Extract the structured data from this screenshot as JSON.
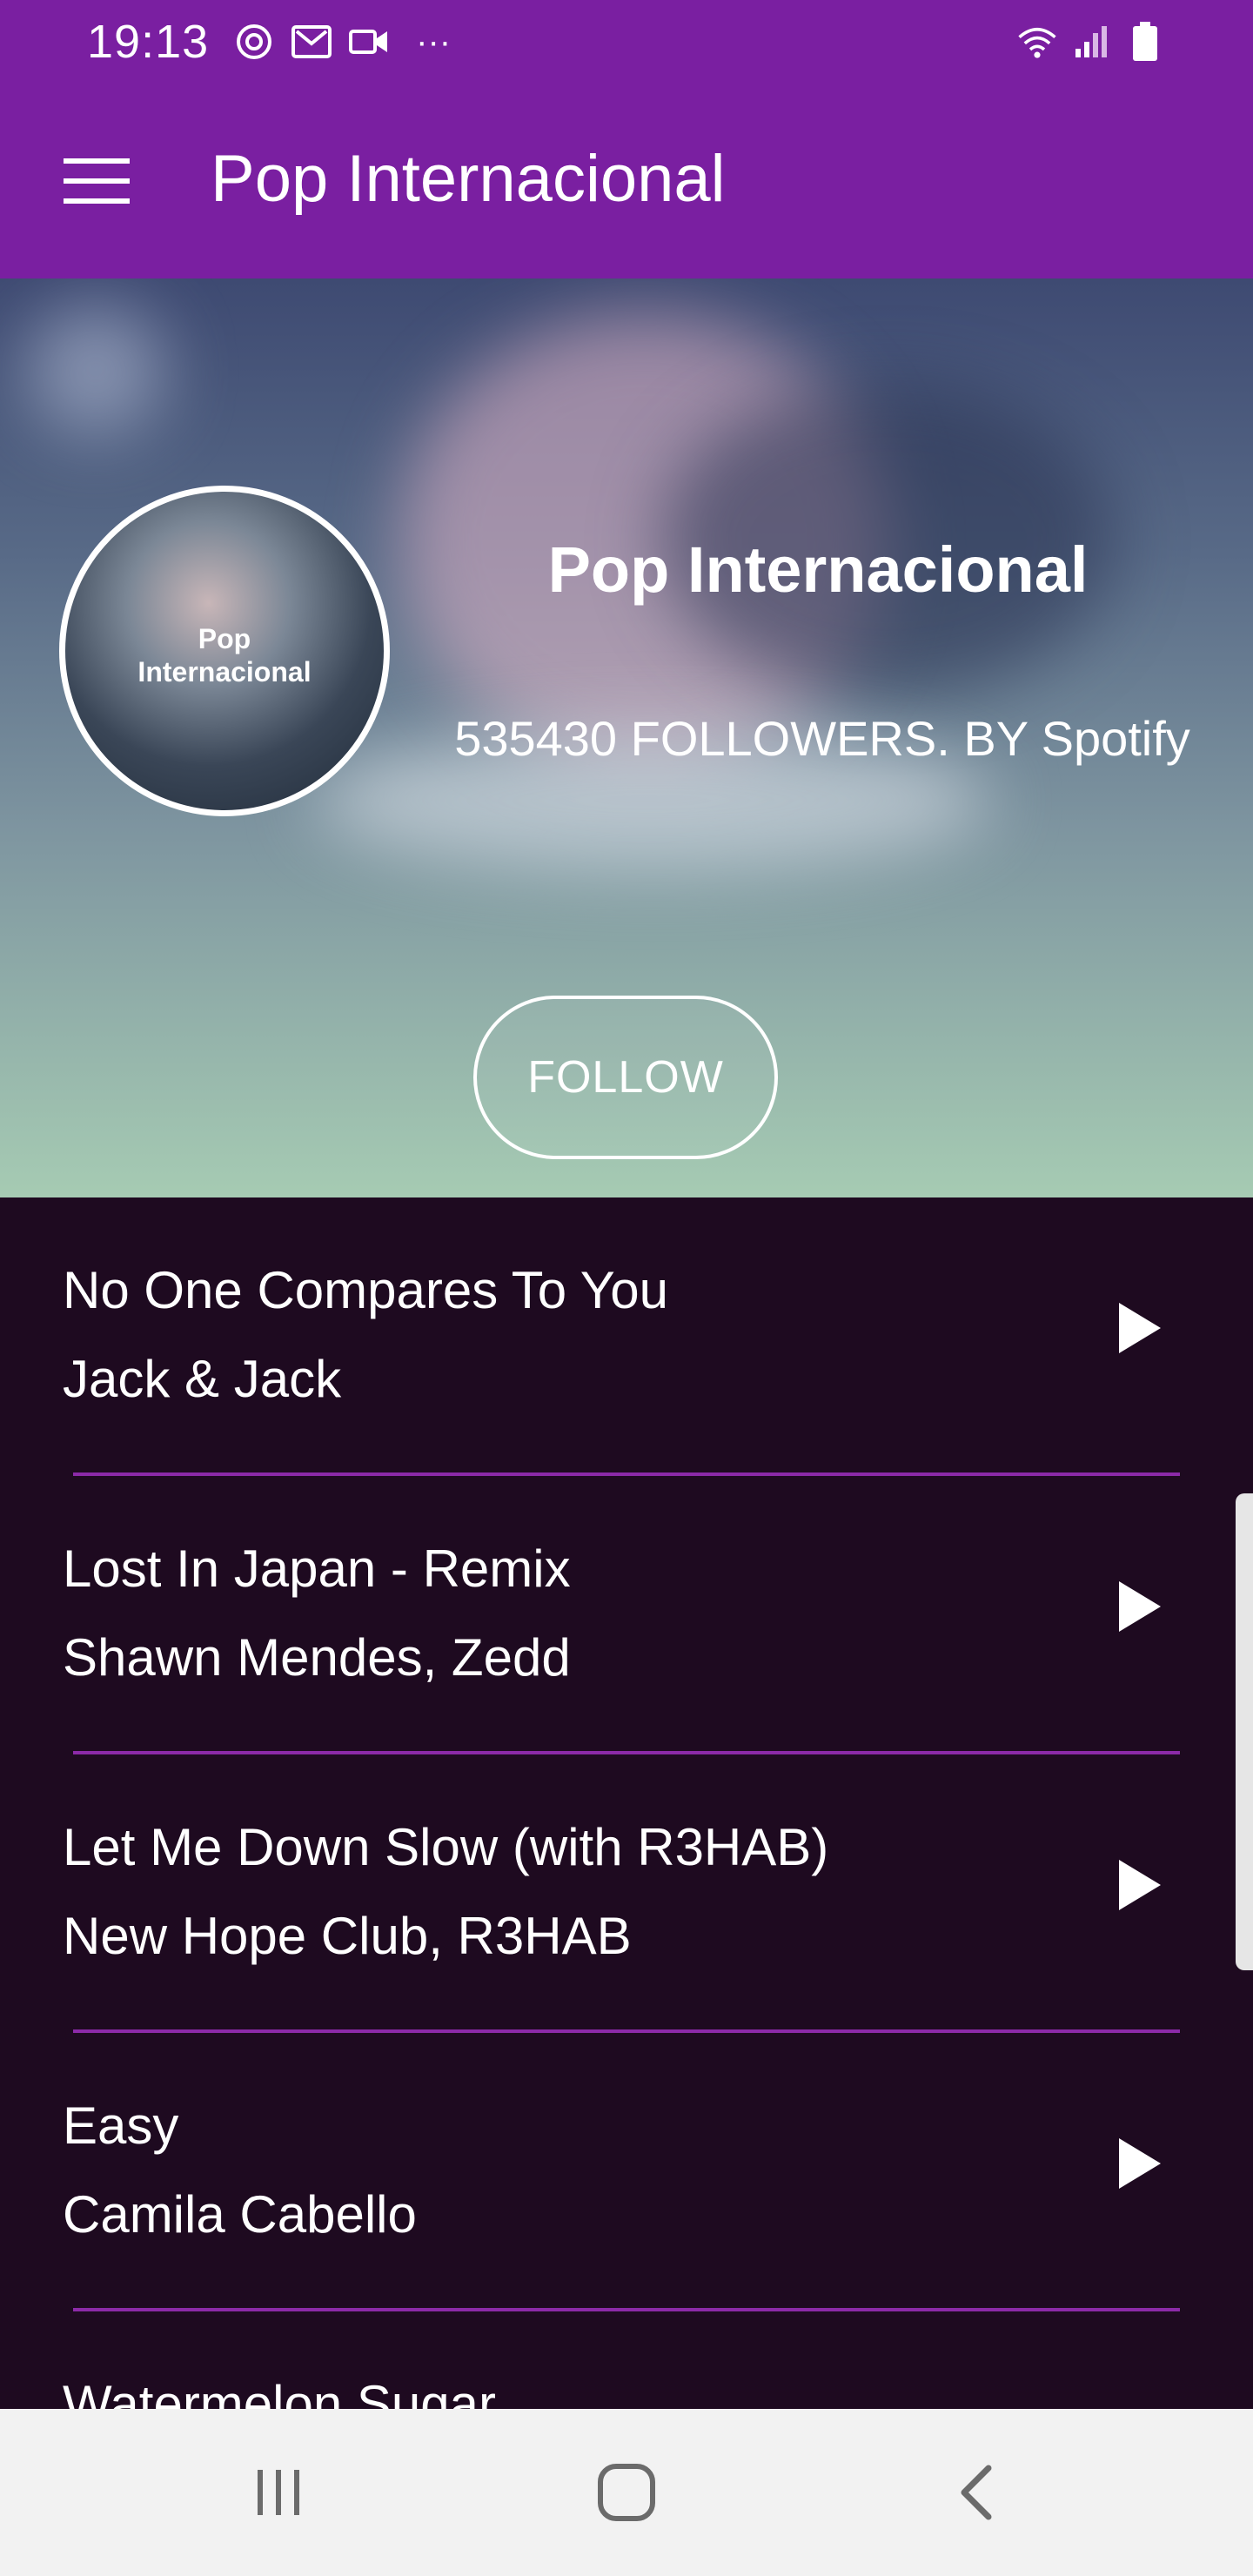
{
  "status_bar": {
    "time": "19:13",
    "left_icons": [
      "spotify-icon",
      "gmail-icon",
      "video-icon",
      "more-icon"
    ],
    "right_icons": [
      "wifi-icon",
      "signal-icon",
      "battery-icon"
    ],
    "overflow_label": "···"
  },
  "app_bar": {
    "title": "Pop Internacional",
    "menu_icon": "hamburger-menu-icon"
  },
  "playlist": {
    "cover_text": "Pop\nInternacional",
    "name": "Pop Internacional",
    "meta": "535430 FOLLOWERS. BY Spotify",
    "follow_label": "FOLLOW"
  },
  "tracks": [
    {
      "title": "No One Compares To You",
      "artist": "Jack & Jack"
    },
    {
      "title": "Lost In Japan - Remix",
      "artist": "Shawn Mendes, Zedd"
    },
    {
      "title": "Let Me Down Slow (with R3HAB)",
      "artist": "New Hope Club, R3HAB"
    },
    {
      "title": "Easy",
      "artist": "Camila Cabello"
    },
    {
      "title": "Watermelon Sugar",
      "artist": ""
    }
  ],
  "nav_bar": {
    "buttons": [
      "recent-apps-icon",
      "home-icon",
      "back-icon"
    ]
  },
  "colors": {
    "primary": "#7a1fa1",
    "list_background": "#1e0a20",
    "divider": "#8c2aa8",
    "nav_background": "#f2f2f2"
  }
}
